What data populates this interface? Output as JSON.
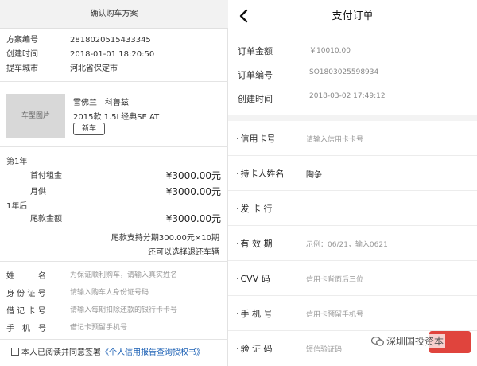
{
  "left": {
    "title": "确认购车方案",
    "info": [
      {
        "k": "方案编号",
        "v": "2818020515433345"
      },
      {
        "k": "创建时间",
        "v": "2018-01-01 18:20:50"
      },
      {
        "k": "提车城市",
        "v": "河北省保定市"
      }
    ],
    "car": {
      "image_label": "车型图片",
      "brand": "雪佛兰　科鲁兹",
      "model": "2015款 1.5L经典SE AT",
      "tag": "新车"
    },
    "first_year": {
      "label": "第1年",
      "down_payment_label": "首付租金",
      "down_payment_value": "¥3000.00元",
      "monthly_label": "月供",
      "monthly_value": "¥3000.00元"
    },
    "after_year": {
      "label": "1年后",
      "final_label": "尾款金额",
      "final_value": "¥3000.00元",
      "note1": "尾款支持分期300.00元×10期",
      "note2": "还可以选择退还车辆"
    },
    "form": [
      {
        "label": "姓　　　名",
        "placeholder": "为保证顺利购车，请输入真实姓名"
      },
      {
        "label": "身 份 证 号",
        "placeholder": "请输入购车人身份证号码"
      },
      {
        "label": "借 记 卡 号",
        "placeholder": "请输入每期扣除还款的银行卡卡号"
      },
      {
        "label": "手　机　号",
        "placeholder": "借记卡预留手机号"
      }
    ],
    "agree_text": "本人已阅读并同意签署",
    "agree_link": "《个人信用报告查询授权书》"
  },
  "right": {
    "back_icon": "chevron-left-icon",
    "title": "支付订单",
    "order": [
      {
        "k": "订单金额",
        "v": "￥10010.00"
      },
      {
        "k": "订单编号",
        "v": "SO1803025598934"
      },
      {
        "k": "创建时间",
        "v": "2018-03-02 17:49:12"
      }
    ],
    "fields": [
      {
        "label": "信用卡号",
        "placeholder": "请输入信用卡卡号",
        "value": ""
      },
      {
        "label": "持卡人姓名",
        "placeholder": "",
        "value": "陶争"
      },
      {
        "label": "发 卡 行",
        "placeholder": "",
        "value": ""
      },
      {
        "label": "有 效 期",
        "placeholder": "示例：06/21，输入0621",
        "value": ""
      },
      {
        "label": "CVV 码",
        "placeholder": "信用卡背面后三位",
        "value": ""
      },
      {
        "label": "手 机 号",
        "placeholder": "信用卡预留手机号",
        "value": ""
      },
      {
        "label": "验 证 码",
        "placeholder": "短信验证码",
        "value": ""
      }
    ],
    "get_code_color": "#e0443d"
  },
  "watermark": "深圳国投资本"
}
